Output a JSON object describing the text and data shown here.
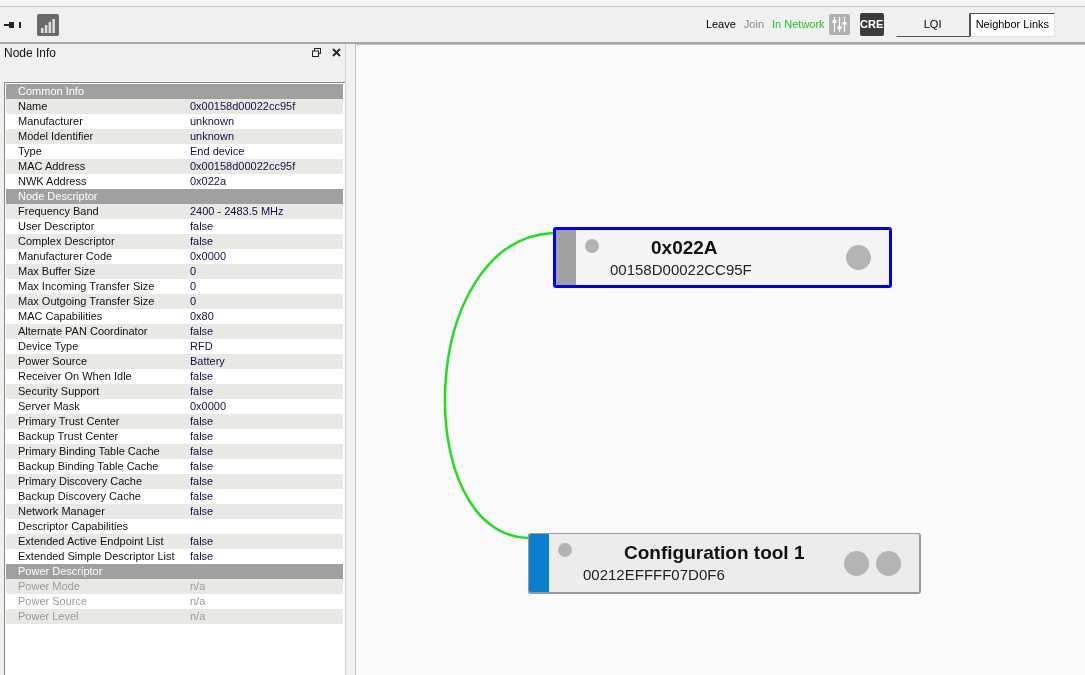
{
  "toolbar": {
    "network_actions": [
      {
        "label": "Leave",
        "kind": "action"
      },
      {
        "label": "Join",
        "kind": "disabled"
      },
      {
        "label": "In Network",
        "kind": "status"
      }
    ],
    "cre_button": "CRE",
    "view_tabs": [
      {
        "label": "LQI",
        "selected": false
      },
      {
        "label": "Neighbor Links",
        "selected": true
      }
    ]
  },
  "panel": {
    "title": "Node Info",
    "rows": [
      {
        "kind": "header",
        "label": "Common Info"
      },
      {
        "kind": "row",
        "label": "Name",
        "value": "0x00158d00022cc95f"
      },
      {
        "kind": "row",
        "label": "Manufacturer",
        "value": "unknown"
      },
      {
        "kind": "row",
        "label": "Model Identifier",
        "value": "unknown"
      },
      {
        "kind": "row",
        "label": "Type",
        "value": "End device"
      },
      {
        "kind": "row",
        "label": "MAC Address",
        "value": "0x00158d00022cc95f"
      },
      {
        "kind": "row",
        "label": "NWK Address",
        "value": "0x022a"
      },
      {
        "kind": "header",
        "label": "Node Descriptor"
      },
      {
        "kind": "row",
        "label": "Frequency Band",
        "value": "2400 - 2483.5 MHz"
      },
      {
        "kind": "row",
        "label": "User Descriptor",
        "value": "false"
      },
      {
        "kind": "row",
        "label": "Complex Descriptor",
        "value": "false"
      },
      {
        "kind": "row",
        "label": "Manufacturer Code",
        "value": "0x0000"
      },
      {
        "kind": "row",
        "label": "Max Buffer Size",
        "value": "0"
      },
      {
        "kind": "row",
        "label": "Max Incoming Transfer Size",
        "value": "0"
      },
      {
        "kind": "row",
        "label": "Max Outgoing Transfer Size",
        "value": "0"
      },
      {
        "kind": "row",
        "label": "MAC Capabilities",
        "value": "0x80"
      },
      {
        "kind": "row",
        "label": "Alternate PAN Coordinator",
        "value": "false"
      },
      {
        "kind": "row",
        "label": "Device Type",
        "value": "RFD"
      },
      {
        "kind": "row",
        "label": "Power Source",
        "value": "Battery"
      },
      {
        "kind": "row",
        "label": "Receiver On When Idle",
        "value": "false"
      },
      {
        "kind": "row",
        "label": "Security Support",
        "value": "false"
      },
      {
        "kind": "row",
        "label": "Server Mask",
        "value": "0x0000"
      },
      {
        "kind": "row",
        "label": "Primary Trust Center",
        "value": "false"
      },
      {
        "kind": "row",
        "label": "Backup Trust Center",
        "value": "false"
      },
      {
        "kind": "row",
        "label": "Primary Binding Table Cache",
        "value": "false"
      },
      {
        "kind": "row",
        "label": "Backup Binding Table Cache",
        "value": "false"
      },
      {
        "kind": "row",
        "label": "Primary Discovery Cache",
        "value": "false"
      },
      {
        "kind": "row",
        "label": "Backup Discovery Cache",
        "value": "false"
      },
      {
        "kind": "row",
        "label": "Network Manager",
        "value": "false"
      },
      {
        "kind": "row",
        "label": "Descriptor Capabilities"
      },
      {
        "kind": "row",
        "label": "Extended Active Endpoint List",
        "value": "false"
      },
      {
        "kind": "row",
        "label": "Extended Simple Descriptor List",
        "value": "false"
      },
      {
        "kind": "header",
        "label": "Power Descriptor"
      },
      {
        "kind": "disabled",
        "label": "Power Mode",
        "value": "n/a"
      },
      {
        "kind": "disabled",
        "label": "Power Source",
        "value": "n/a"
      },
      {
        "kind": "disabled",
        "label": "Power Level",
        "value": "n/a"
      }
    ]
  },
  "canvas": {
    "nodes": [
      {
        "title": "0x022A",
        "address": "00158D00022CC95F",
        "color": "#a0a0a0",
        "selected": true,
        "endpoints": [
          {
            "kind": "dot"
          }
        ]
      },
      {
        "title": "Configuration tool 1",
        "address": "00212EFFFF07D0F6",
        "color": "#0a7fd0",
        "selected": false,
        "endpoints": [
          {
            "kind": "dot"
          },
          {
            "kind": "dot"
          }
        ]
      }
    ]
  }
}
